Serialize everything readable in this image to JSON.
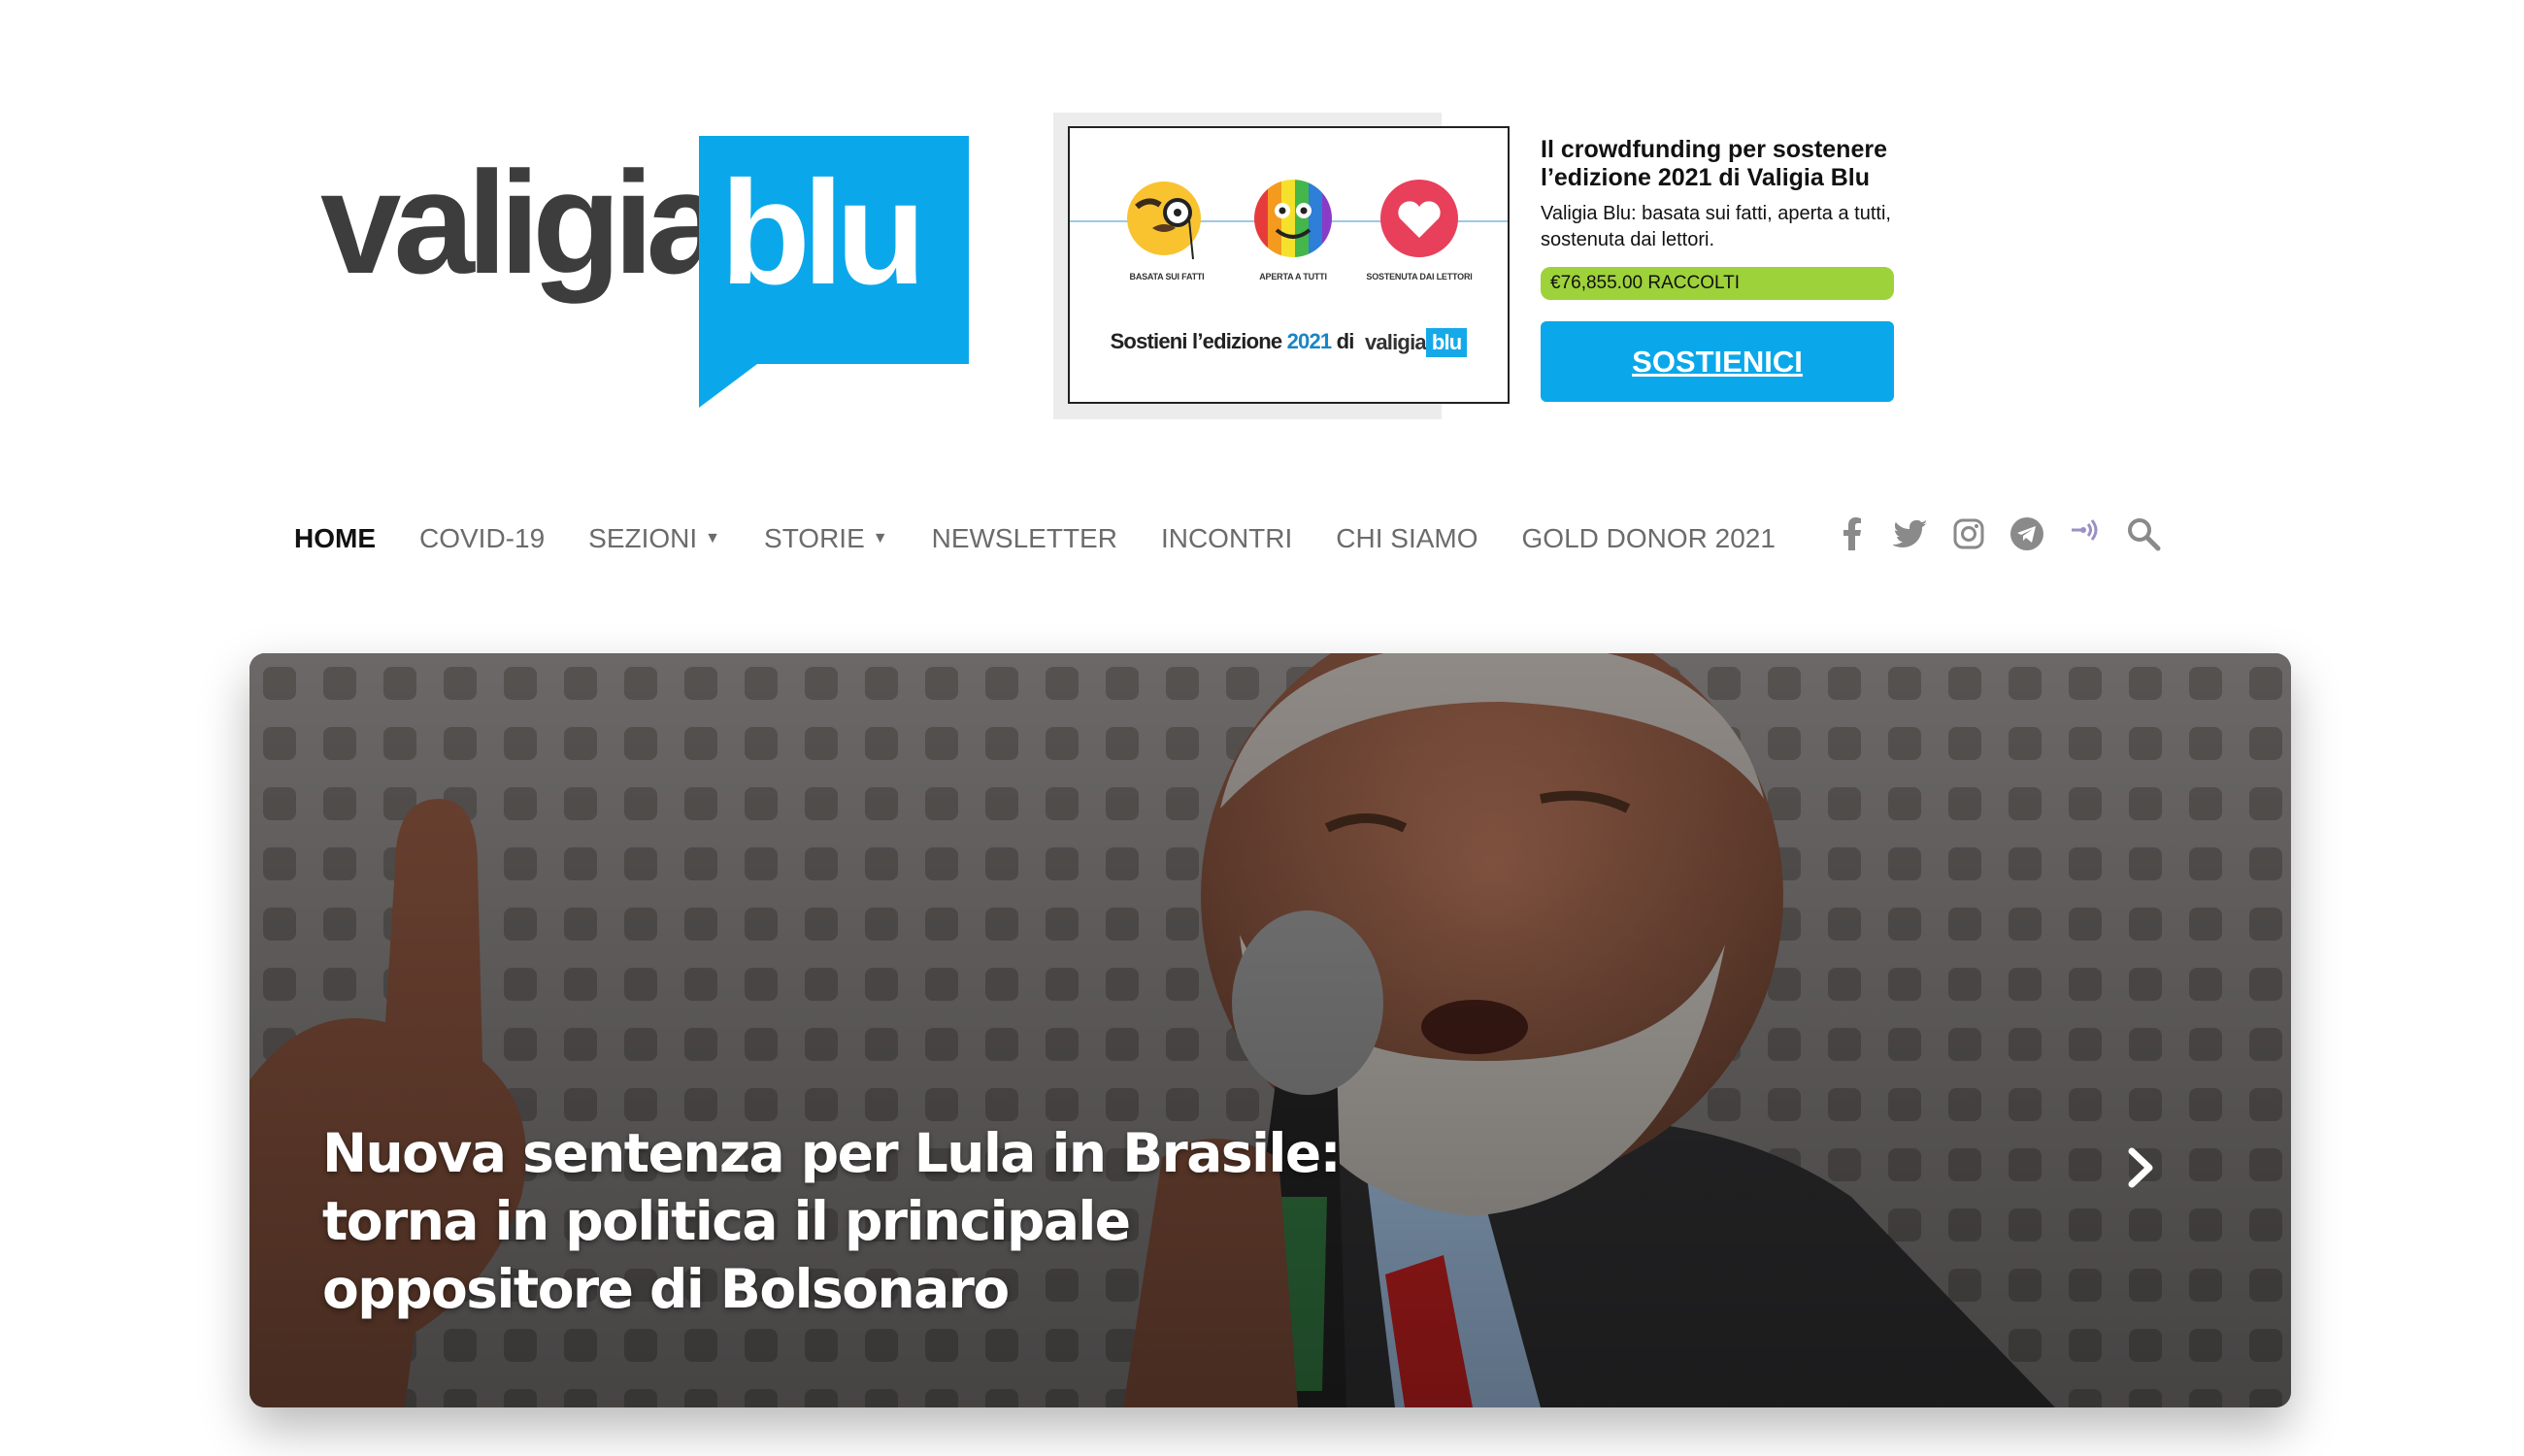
{
  "site": {
    "logo_word": "valigia",
    "logo_box_word": "blu",
    "brand_color": "#0aa8ea"
  },
  "banner": {
    "captions": [
      "BASATA SUI FATTI",
      "APERTA A TUTTI",
      "SOSTENUTA DAI LETTORI"
    ],
    "cta_prefix": "Sostieni l’edizione",
    "cta_year": "2021",
    "cta_suffix": "di",
    "cta_logo_word": "valigia",
    "cta_logo_box": "blu"
  },
  "crowdfunding": {
    "title": "Il crowdfunding per sostenere l’edizione 2021 di Valigia Blu",
    "description": "Valigia Blu: basata sui fatti, aperta a tutti, sostenuta dai lettori.",
    "raised": "€76,855.00 RACCOLTI",
    "raised_progress_color": "#9ed23a",
    "button": "SOSTIENICI"
  },
  "nav": {
    "items": [
      {
        "label": "HOME",
        "active": true
      },
      {
        "label": "COVID-19"
      },
      {
        "label": "SEZIONI",
        "dropdown": true
      },
      {
        "label": "STORIE",
        "dropdown": true
      },
      {
        "label": "NEWSLETTER"
      },
      {
        "label": "INCONTRI"
      },
      {
        "label": "CHI SIAMO"
      },
      {
        "label": "GOLD DONOR 2021"
      }
    ],
    "icons": [
      "facebook-icon",
      "twitter-icon",
      "instagram-icon",
      "telegram-icon",
      "podcast-icon",
      "search-icon"
    ]
  },
  "hero": {
    "title_lines": [
      "Nuova sentenza per Lula in Brasile:",
      "torna in politica il principale",
      "oppositore di Bolsonaro"
    ],
    "next_icon": "chevron-right-icon"
  }
}
